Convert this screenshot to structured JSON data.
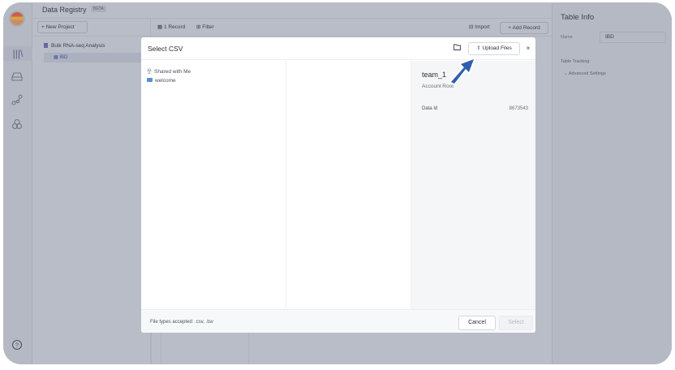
{
  "app": {
    "title": "Data Registry",
    "beta_badge": "BETA"
  },
  "sidebar": {
    "new_project_label": "+ New Project",
    "project_label": "Bulk RNA-seq Analysis",
    "table_label": "IBD"
  },
  "toolbar": {
    "records_label": "1 Record",
    "filter_label": "Filter",
    "import_label": "Import",
    "add_record_label": "+ Add Record"
  },
  "right_panel": {
    "title": "Table Info",
    "name_label": "Name",
    "name_value": "IBD",
    "tracking_label": "Table Tracking",
    "advanced_label": "Advanced Settings"
  },
  "modal": {
    "title": "Select CSV",
    "upload_label": "Upload Files",
    "close_label": "×",
    "browser": {
      "items": [
        {
          "label": "Shared with Me",
          "icon": "users-icon"
        },
        {
          "label": "welcome",
          "icon": "folder-icon"
        }
      ]
    },
    "details": {
      "name": "team_1",
      "subtitle": "Account Root",
      "data_id_label": "Data Id",
      "data_id_value": "8673543"
    },
    "footer": {
      "file_types": "File types accepted: .csv, .tsv",
      "cancel_label": "Cancel",
      "select_label": "Select"
    }
  },
  "colors": {
    "overlay": "#b9bdc7",
    "accent": "#4b5290",
    "pointer": "#2f5fae",
    "folder": "#4f92d9"
  }
}
